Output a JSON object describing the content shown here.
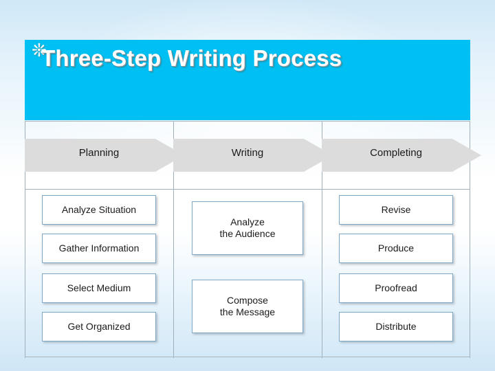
{
  "slide": {
    "title": "Three-Step Writing Process",
    "title_bullet_icon": "star-icon",
    "banner_color": "#00C0F3",
    "columns": [
      {
        "header": "Planning",
        "items": [
          {
            "lines": [
              "Analyze Situation"
            ]
          },
          {
            "lines": [
              "Gather Information"
            ]
          },
          {
            "lines": [
              "Select Medium"
            ]
          },
          {
            "lines": [
              "Get Organized"
            ]
          }
        ]
      },
      {
        "header": "Writing",
        "items": [
          {
            "lines": [
              "Analyze",
              "the Audience"
            ]
          },
          {
            "lines": [
              "Compose",
              "the Message"
            ]
          }
        ]
      },
      {
        "header": "Completing",
        "items": [
          {
            "lines": [
              "Revise"
            ]
          },
          {
            "lines": [
              "Produce"
            ]
          },
          {
            "lines": [
              "Proofread"
            ]
          },
          {
            "lines": [
              "Distribute"
            ]
          }
        ]
      }
    ],
    "chevron_color": "#DCDCDC"
  }
}
